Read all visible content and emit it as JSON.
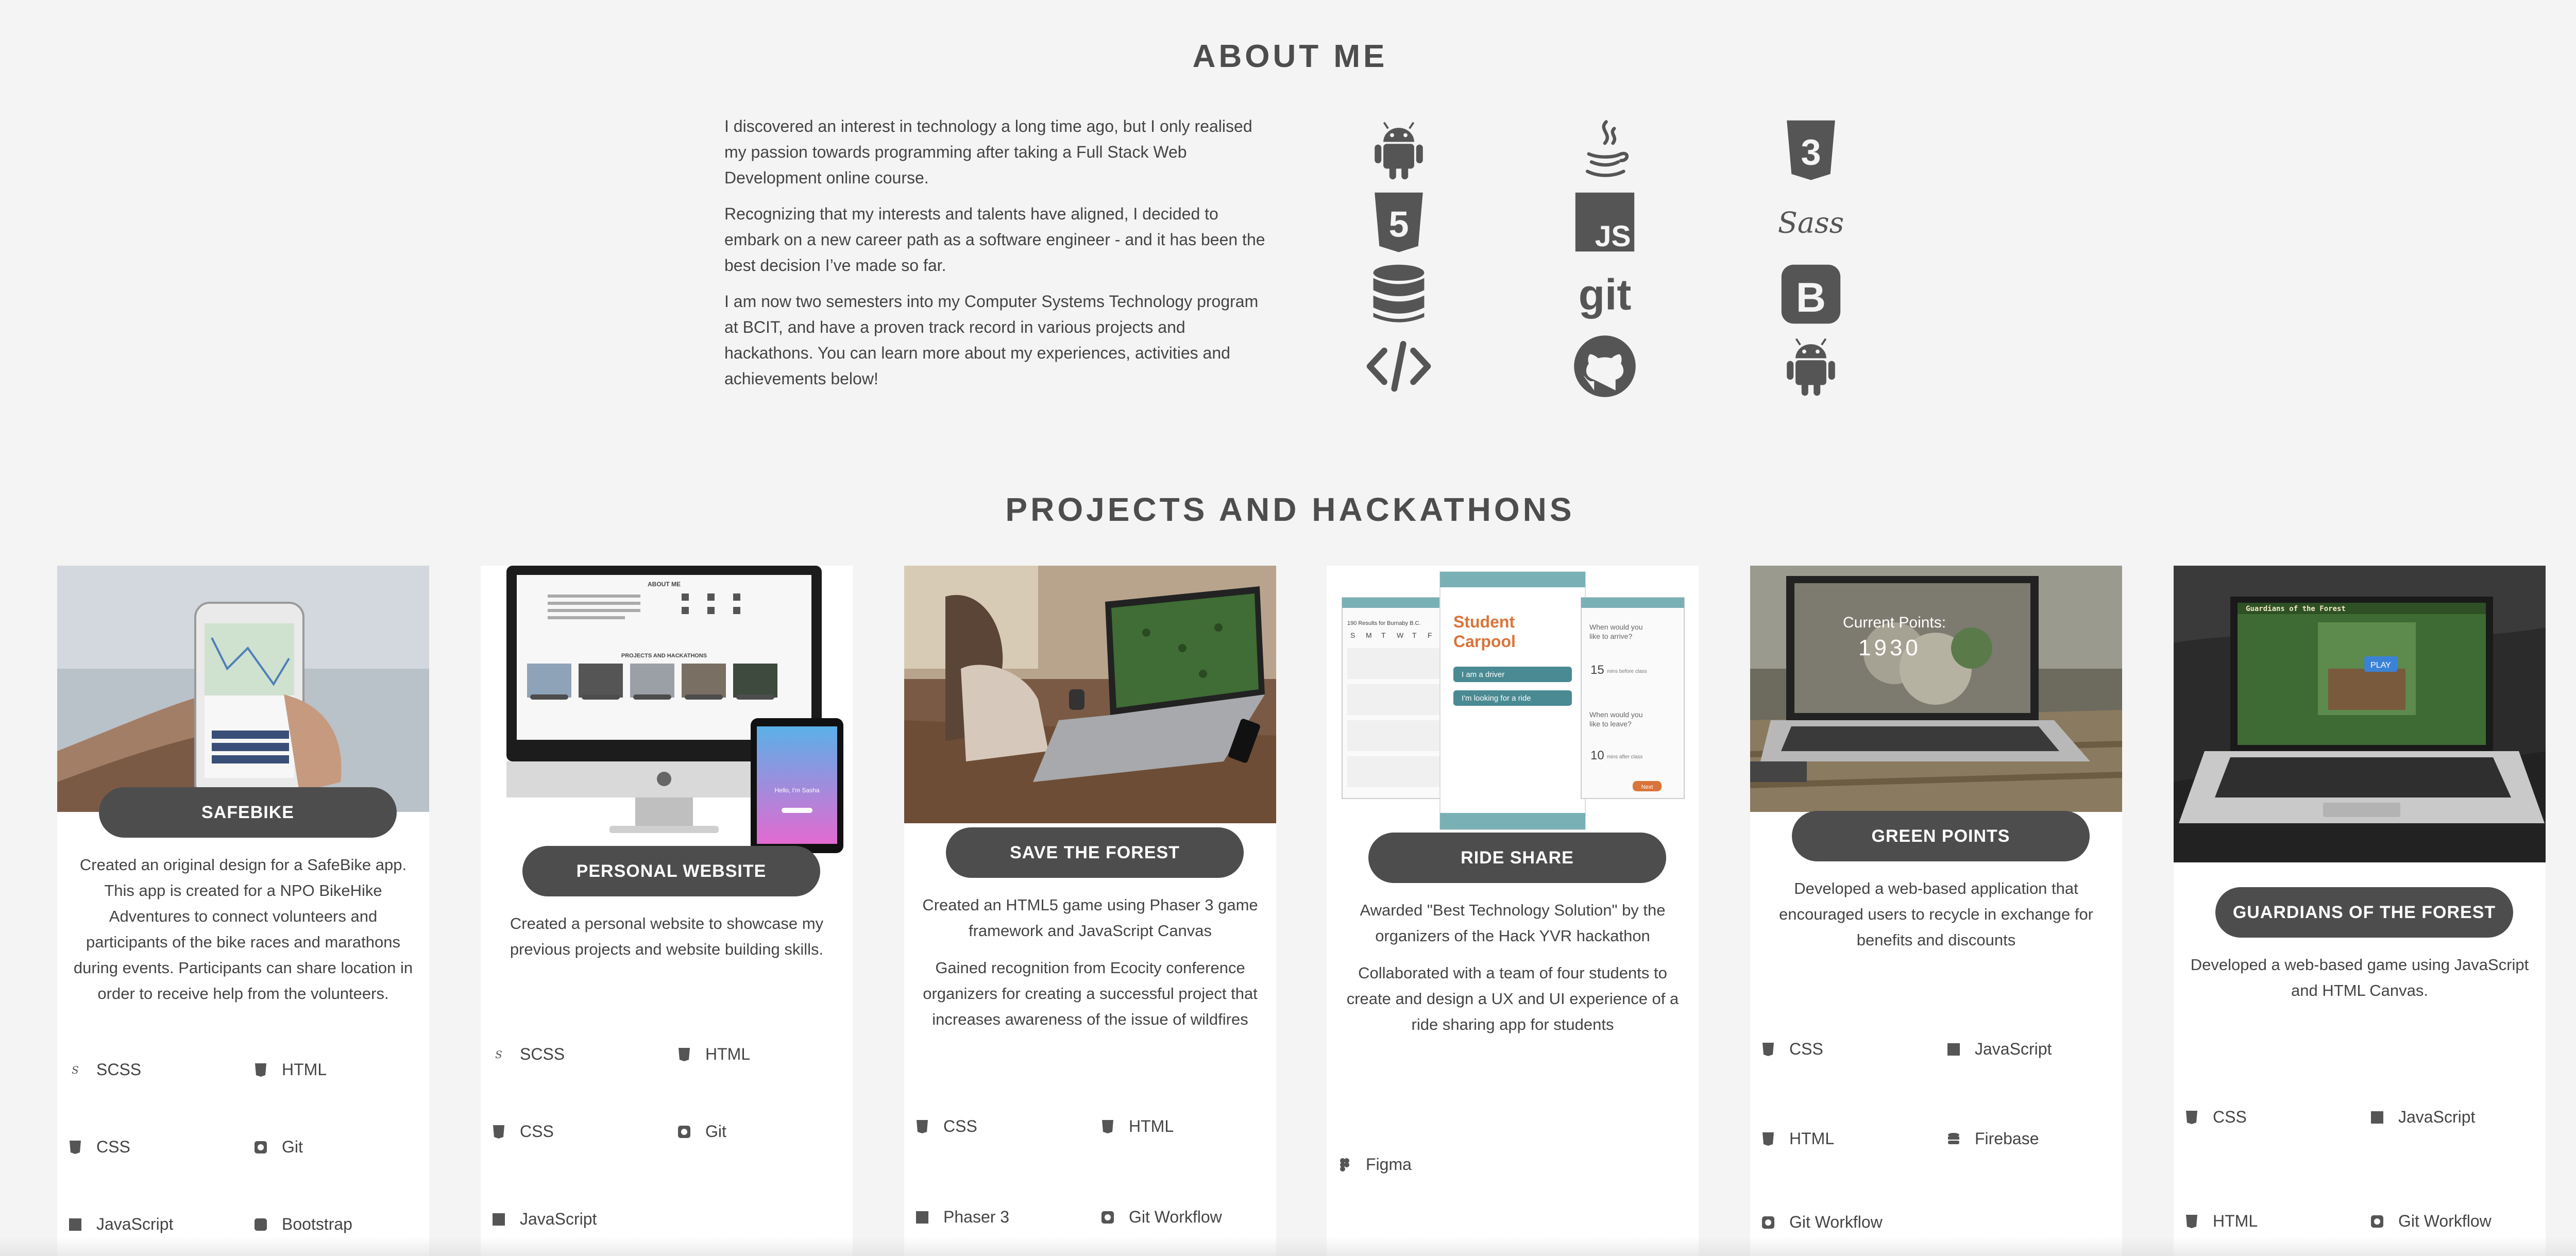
{
  "about": {
    "title": "ABOUT ME",
    "paragraphs": [
      "I discovered an interest in technology a long time ago, but I only realised my passion towards programming after taking a Full Stack Web Development online course.",
      "Recognizing that my interests and talents have aligned, I decided to embark on a new career path as a software engineer - and it has been the best decision I’ve made so far.",
      "I am now two semesters into my Computer Systems Technology program at BCIT, and have a proven track record in various projects and hackathons. You can learn more about my experiences, activities and achievements below!"
    ],
    "skill_icons": [
      "android-icon",
      "java-icon",
      "css3-icon",
      "html5-icon",
      "javascript-icon",
      "sass-icon",
      "database-icon",
      "git-icon",
      "bootstrap-icon",
      "code-icon",
      "github-icon",
      "android-icon"
    ],
    "skill_labels": {
      "js": "JS",
      "git": "git",
      "sass": "Sass",
      "bootstrap": "B"
    }
  },
  "projects": {
    "title": "PROJECTS AND HACKATHONS",
    "cards": [
      {
        "title": "SAFEBIKE",
        "paragraphs": [
          "Created an original design for a SafeBike app. This app is created for a NPO BikeHike Adventures to connect volunteers and participants of the bike races and marathons during events. Participants can share location in order to receive help from the volunteers."
        ],
        "tech": [
          {
            "label": "SCSS",
            "icon": "sass-icon"
          },
          {
            "label": "HTML",
            "icon": "html5-icon"
          },
          {
            "label": "CSS",
            "icon": "css3-icon"
          },
          {
            "label": "Git",
            "icon": "git-icon"
          },
          {
            "label": "JavaScript",
            "icon": "javascript-icon"
          },
          {
            "label": "Bootstrap",
            "icon": "bootstrap-icon"
          }
        ]
      },
      {
        "title": "PERSONAL WEBSITE",
        "paragraphs": [
          "Created a personal website to showcase my previous projects and website building skills."
        ],
        "mock": {
          "about_label": "ABOUT ME",
          "projects_label": "PROJECTS AND HACKATHONS",
          "tablet_text": "Hello, I'm Sasha"
        },
        "tech": [
          {
            "label": "SCSS",
            "icon": "sass-icon"
          },
          {
            "label": "HTML",
            "icon": "html5-icon"
          },
          {
            "label": "CSS",
            "icon": "css3-icon"
          },
          {
            "label": "Git",
            "icon": "git-icon"
          },
          {
            "label": "JavaScript",
            "icon": "javascript-icon"
          }
        ]
      },
      {
        "title": "SAVE THE FOREST",
        "paragraphs": [
          "Created an HTML5 game using Phaser 3 game framework and JavaScript Canvas",
          "Gained recognition from Ecocity conference organizers for creating a successful project that increases awareness of the issue of wildfires"
        ],
        "tech": [
          {
            "label": "CSS",
            "icon": "css3-icon"
          },
          {
            "label": "HTML",
            "icon": "html5-icon"
          },
          {
            "label": "Phaser 3",
            "icon": "javascript-icon"
          },
          {
            "label": "Git Workflow",
            "icon": "git-icon"
          }
        ]
      },
      {
        "title": "RIDE SHARE",
        "paragraphs": [
          "Awarded \"Best Technology Solution\" by the organizers of the Hack YVR hackathon",
          "Collaborated with a team of four students to create and design a UX and UI experience of a ride sharing app for students"
        ],
        "mock": {
          "app_title": "Student Carpool",
          "driver_btn": "I am a driver",
          "ride_btn": "I'm looking for a ride",
          "arrive_q": "When would you like to arrive?",
          "leave_q": "When would you like to leave?",
          "arrive_val": "15",
          "leave_val": "10",
          "before_text": "mins before class",
          "after_text": "mins after class",
          "next_btn": "Next",
          "calendar_heading": "190 Results for Burnaby B.C.",
          "days": [
            "S",
            "M",
            "T",
            "W",
            "T",
            "F"
          ]
        },
        "tech": [
          {
            "label": "Figma",
            "icon": "figma-icon"
          }
        ]
      },
      {
        "title": "GREEN POINTS",
        "paragraphs": [
          "Developed a web-based application that encouraged users to recycle in exchange for benefits and discounts"
        ],
        "mock": {
          "points_label": "Current Points:",
          "points_value": "1930"
        },
        "tech": [
          {
            "label": "CSS",
            "icon": "css3-icon"
          },
          {
            "label": "JavaScript",
            "icon": "javascript-icon"
          },
          {
            "label": "HTML",
            "icon": "html5-icon"
          },
          {
            "label": "Firebase",
            "icon": "database-icon"
          },
          {
            "label": "Git Workflow",
            "icon": "git-icon"
          }
        ]
      },
      {
        "title": "GUARDIANS OF THE FOREST",
        "paragraphs": [
          "Developed a web-based game using JavaScript and HTML Canvas."
        ],
        "mock": {
          "game_title": "Guardians of the Forest",
          "play_label": "PLAY"
        },
        "tech": [
          {
            "label": "CSS",
            "icon": "css3-icon"
          },
          {
            "label": "JavaScript",
            "icon": "javascript-icon"
          },
          {
            "label": "HTML",
            "icon": "html5-icon"
          },
          {
            "label": "Git Workflow",
            "icon": "git-icon"
          }
        ]
      }
    ]
  }
}
